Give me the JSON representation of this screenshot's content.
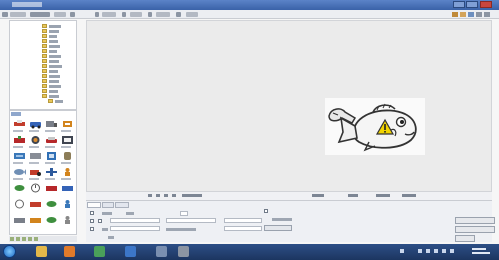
{
  "app": {
    "title": "",
    "colors": {
      "titlebar": "#3a62a8",
      "taskbar": "#1c3560",
      "stage": "#ebebeb",
      "sprite_bg": "#fafafa"
    }
  },
  "toolbar": {
    "buttons": [
      "",
      "",
      "",
      "",
      "",
      "",
      "",
      "",
      "",
      "",
      "",
      "",
      ""
    ],
    "window_buttons": [
      "minimize",
      "maximize",
      "close"
    ]
  },
  "tree": {
    "items": [
      "",
      "",
      "",
      "",
      "",
      "",
      "",
      "",
      "",
      "",
      "",
      "",
      "",
      "",
      "",
      ""
    ]
  },
  "sprites": {
    "header": "",
    "items": [
      {
        "icon": "tools-icon",
        "color": "#c23d2c"
      },
      {
        "icon": "cars-icon",
        "color": "#3463b7"
      },
      {
        "icon": "truck-icon",
        "color": "#7a7f89"
      },
      {
        "icon": "hammer-icon",
        "color": "#d2841d"
      },
      {
        "icon": "box-icon",
        "color": "#3e8f3e"
      },
      {
        "icon": "engine-icon",
        "color": "#3f4550"
      },
      {
        "icon": "car-icon",
        "color": "#b6282a"
      },
      {
        "icon": "wrench-icon",
        "color": "#d98b2f"
      },
      {
        "icon": "battery-icon",
        "color": "#3f4550"
      },
      {
        "icon": "trailer-icon",
        "color": "#3a78b9"
      },
      {
        "icon": "motor-icon",
        "color": "#888d96"
      },
      {
        "icon": "barrel-icon",
        "color": "#2f6fb5"
      },
      {
        "icon": "fish-icon",
        "color": "#8c7d58"
      },
      {
        "icon": "tractor-icon",
        "color": "#c23d2c"
      },
      {
        "icon": "plane-icon",
        "color": "#2d5a9c"
      },
      {
        "icon": "person-icon",
        "color": "#d2841d"
      },
      {
        "icon": "leaf-icon",
        "color": "#3e8f3e"
      },
      {
        "icon": "clock-icon",
        "color": "#6f8fb5"
      }
    ]
  },
  "stage": {
    "sprite_name": "fish-with-wrench",
    "warning_icon": "warning-icon",
    "status_items": [
      "",
      "",
      "",
      "",
      "",
      "",
      "",
      "",
      ""
    ]
  },
  "properties": {
    "tabs": [
      "",
      "",
      ""
    ],
    "labels": [
      "",
      "",
      "",
      "",
      "",
      ""
    ],
    "buttons": [
      "",
      ""
    ]
  },
  "right_controls": [
    "",
    "",
    ""
  ],
  "taskbar": {
    "apps": [
      "explorer-icon",
      "media-icon",
      "app-icon",
      "app-icon",
      "app-icon",
      "app-icon",
      "app-icon",
      "app-icon"
    ],
    "clock_time": "",
    "clock_date": ""
  }
}
